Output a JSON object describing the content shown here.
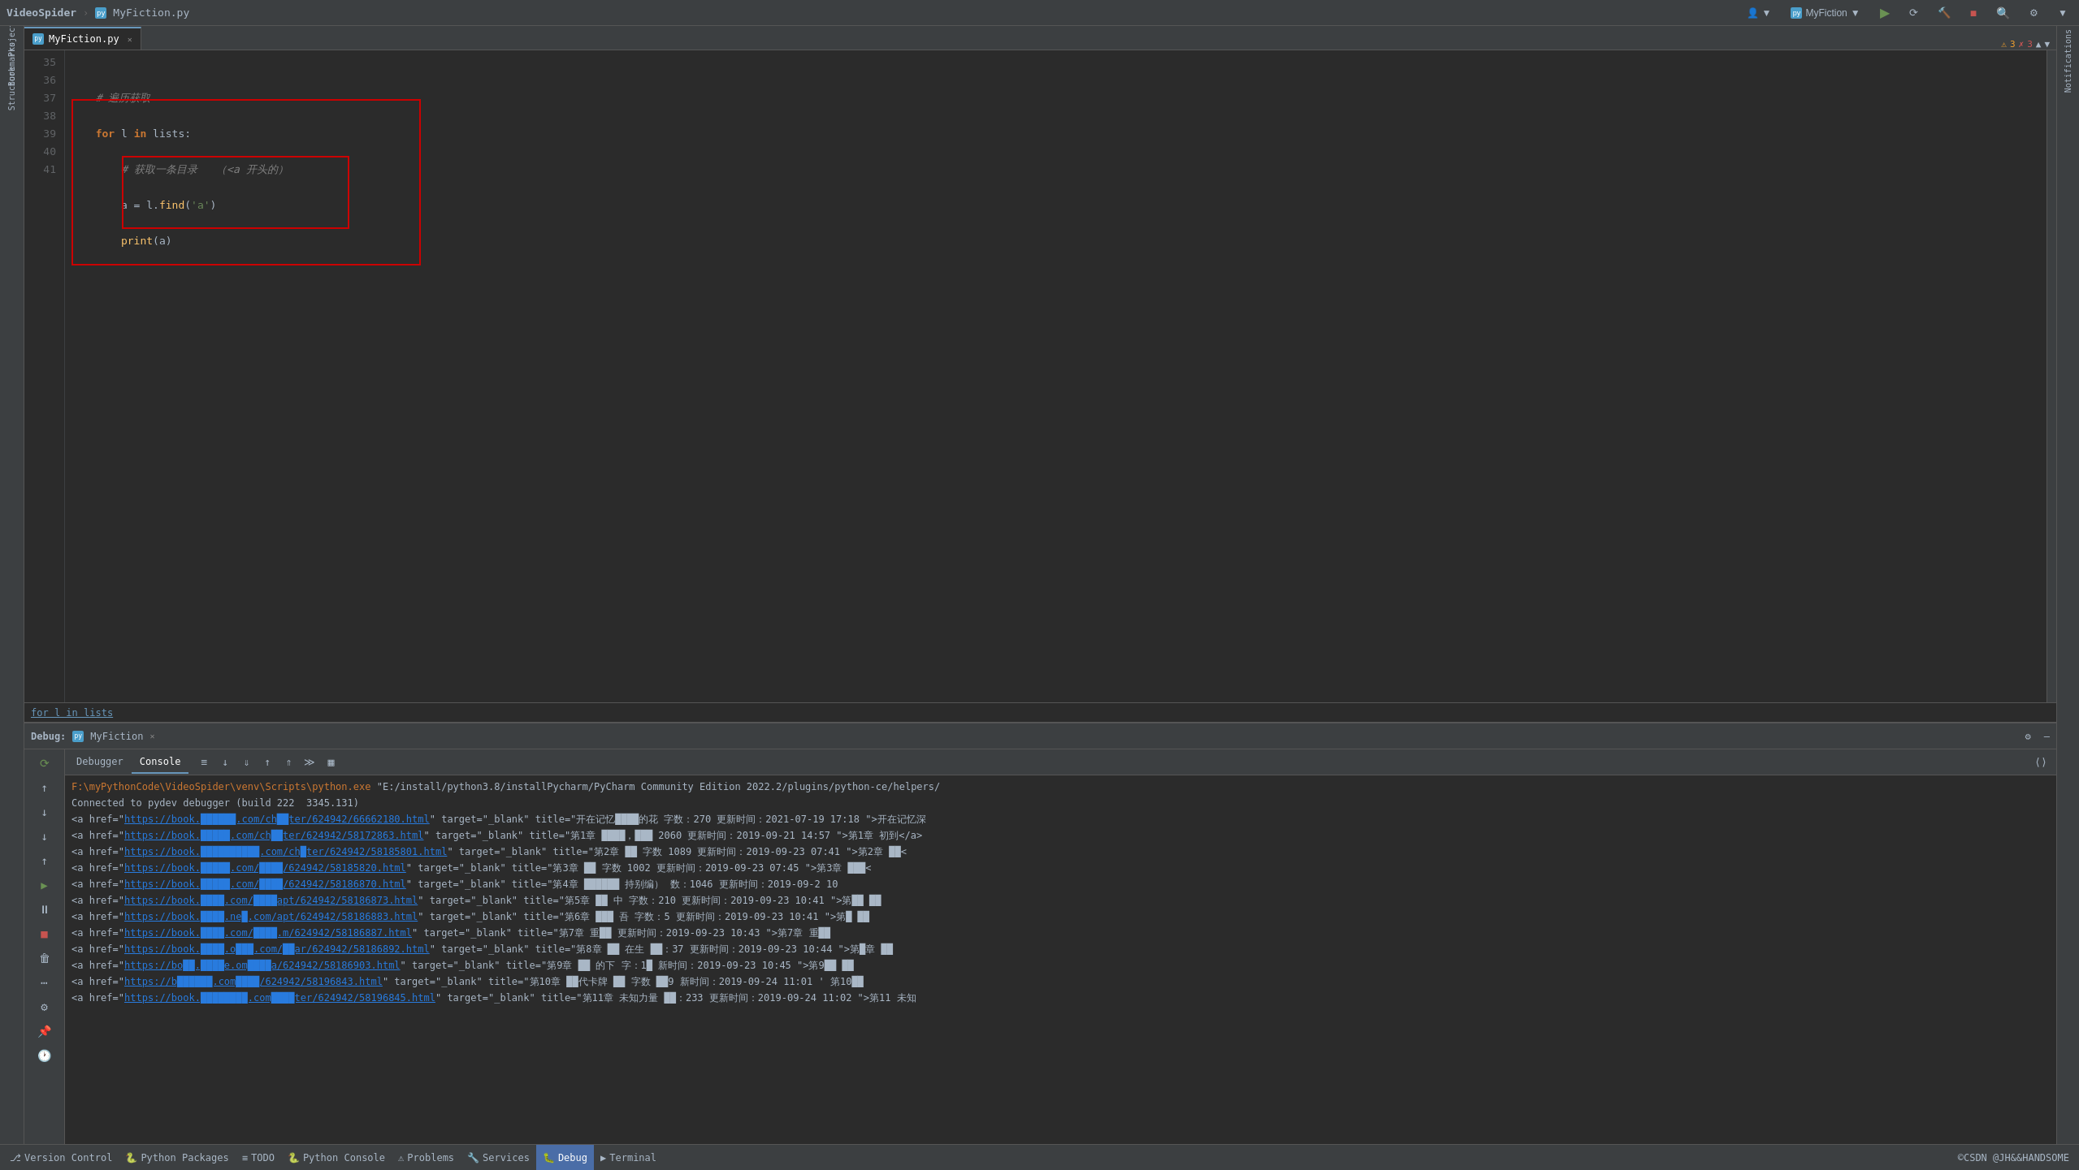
{
  "titleBar": {
    "brand": "VideoSpider",
    "separator": "›",
    "file": "MyFiction.py",
    "runConfig": "MyFiction",
    "buttons": {
      "run": "▶",
      "rerun": "↺",
      "buildArtifacts": "🔨",
      "stop": "■",
      "search": "🔍",
      "settings": "⚙",
      "more": "▼"
    }
  },
  "editor": {
    "tab": {
      "label": "MyFiction.py",
      "icon": "python"
    },
    "lines": [
      {
        "num": 35,
        "content": ""
      },
      {
        "num": 36,
        "content": "  # 遍历获取"
      },
      {
        "num": 37,
        "content": "  for l in lists:"
      },
      {
        "num": 38,
        "content": "      # 获取一条目录   （<a 开头的）"
      },
      {
        "num": 39,
        "content": "      a = l.find('a')"
      },
      {
        "num": 40,
        "content": "      print(a)"
      },
      {
        "num": 41,
        "content": ""
      }
    ],
    "breadcrumb": "for l in lists"
  },
  "debugPanel": {
    "label": "Debug:",
    "sessionTab": "MyFiction",
    "tabs": [
      "Debugger",
      "Console"
    ],
    "activeTab": "Console",
    "toolbar": [
      "≡",
      "↓",
      "↓",
      "↑",
      "↑",
      "≫",
      "▦"
    ],
    "consoleOutput": [
      "F:\\myPythonCode\\VideoSpider\\venv\\Scripts\\python.exe \"E:/install/python3.8/installPycharm/PyCharm Community Edition 2022.2/plugins/python-ce/helpers/",
      "Connected to pydev debugger (build 222 3345.131)",
      "<a href=\"https://book.█████.com/chapter/624942/66662180.html\" target=\"_blank\" title=\"开在记忆深处的花 字数：270 更新时间：2021-07-19 17:18 \">开在记忆深",
      "<a href=\"https://book.█████.com/chapter/624942/58172863.html\" target=\"_blank\" title=\"第1章 ███，███ 2060 更新时间：2019-09-21 14:57 \">第1章 初到</a>",
      "<a href=\"https://book.█████████.com/chapter/624942/58185801.html\" target=\"_blank\" title=\"第2章 ██ 字数 1089 更新时间：2019-09-23 07:41 \">第2章 ██<",
      "<a href=\"https://book.█████.com/████/624942/58185820.html\" target=\"_blank\" title=\"第3章 ██ 字数 1002 更新时间：2019-09-23 07:45 \">第3章 ███<",
      "<a href=\"https://book.█████.com/████/624942/58186870.html\" target=\"_blank\" title=\"第4章 ██████ 持别编） 数：1046 更新时间：2019-09-2 10 ",
      "<a href=\"https://book.████.com/████apt/624942/58186873.html\" target=\"_blank\" title=\"第5章 ██ 中 字数：210 更新时间：2019-09-23 10:41 \">第██ ██",
      "<a href=\"https://book.████.ne█.com/apt/624942/58186883.html\" target=\"_blank\" title=\"第6章 ███ 吾 字数：5 更新时间：2019-09-23 10:41 \">第█ ██",
      "<a href=\"https://book.████.com/████.m/624942/58186887.html\" target=\"_blank\" title=\"第7章 重██ 更新时间：2019-09-23 10:43 \">第7章 重██",
      "<a href=\"https://book.████.o███.com/██ar/624942/58186892.html\" target=\"_blank\" title=\"第8章 ██ 在生 ██：37 更新时间：2019-09-23 10:44 \">第█章 ██",
      "<a href=\"https://bo██.████e.om████a/624942/58186903.html\" target=\"_blank\" title=\"第9章 ██ 的下 字：1█ 新时间：2019-09-23 10:45 \">第9██ ██",
      "<a href=\"https://b██████.com████/624942/58196843.html\" target=\"_blank\" title=\"第10章 ██代卡牌 ██ 字数 ██9 新时间：2019-09-24 11:01 ' 第10██",
      "<a href=\"https://book.████████.com████ter/624942/58196845.html\" target=\"_blank\" title=\"第11章 未知力量 ██：233 更新时间：2019-09-24 11:02 \">第11 未知"
    ]
  },
  "statusBar": {
    "items": [
      {
        "label": "Version Control",
        "icon": "⎇"
      },
      {
        "label": "Python Packages",
        "icon": "🐍"
      },
      {
        "label": "TODO",
        "icon": "≡"
      },
      {
        "label": "Python Console",
        "icon": "🐍"
      },
      {
        "label": "Problems",
        "icon": "⚠"
      },
      {
        "label": "Services",
        "icon": "🔧"
      },
      {
        "label": "Debug",
        "icon": "🐛",
        "active": true
      },
      {
        "label": "Terminal",
        "icon": "▶"
      }
    ],
    "copyright": "©CSDN @JH&&HANDSOME"
  },
  "rightInfo": {
    "warnings": "3",
    "errors": "3"
  }
}
